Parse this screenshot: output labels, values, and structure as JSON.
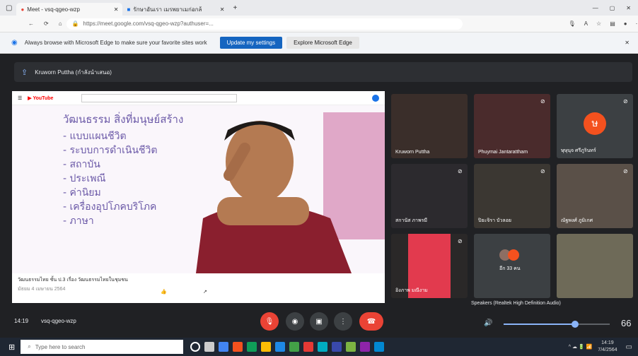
{
  "browser": {
    "tabs": [
      {
        "label": "Meet - vsq-qgeo-wzp"
      },
      {
        "label": "รักษาอันเรา เมรพยาเมก่อกล้"
      }
    ],
    "address": "https://meet.google.com/vsq-qgeo-wzp?authuser=...",
    "infobar_text": "Always browse with Microsoft Edge to make sure your favorite sites work",
    "update_btn": "Update my settings",
    "explore_btn": "Explore Microsoft Edge"
  },
  "meet": {
    "presenter_label": "Kruworn Puttha (กำลังนำเสนอ)",
    "meeting_time": "14:19",
    "meeting_code": "vsq-qgeo-wzp",
    "slide": {
      "heading": "วัฒนธรรม สิ่งที่มนุษย์สร้าง",
      "items": [
        "- แบบแผนชีวิต",
        "- ระบบการดำเนินชีวิต",
        "- สถาบัน",
        "- ประเพณี",
        "- ค่านิยม",
        "- เครื่องอุปโภคบริโภค",
        "- ภาษา"
      ]
    },
    "video_title": "วัฒนธรรมไทย ชั้น ป.3 เรื่อง วัฒนธรรมไทยในชุมชน",
    "video_meta": "มัธยม 4 เมษายน 2564",
    "participants": [
      {
        "name": "Kruworn Puttha"
      },
      {
        "name": "Phuymai Jantarattham"
      },
      {
        "name": "ษุษุนุจ ศรีภูรินทร์",
        "avatar_letter": "ษ",
        "avatar_color": "#f4511e"
      },
      {
        "name": "สกานัส ภาพรมี"
      },
      {
        "name": "ปิยะจิรา บัวลอย"
      },
      {
        "name": "ณัฐพงศ์ ภูมิเกศ"
      },
      {
        "name": "อิงภาพ มณีงาม"
      },
      {
        "name": "อีก 33 คน"
      },
      {
        "name": ""
      }
    ],
    "speaker_label": "Speakers (Realtek High Definition Audio)",
    "volume": 66
  },
  "taskbar": {
    "search_placeholder": "Type here to search",
    "time": "14:19",
    "date": "7/4/2564"
  },
  "colors": {
    "end_call": "#ea4335",
    "accent": "#1a73e8"
  }
}
